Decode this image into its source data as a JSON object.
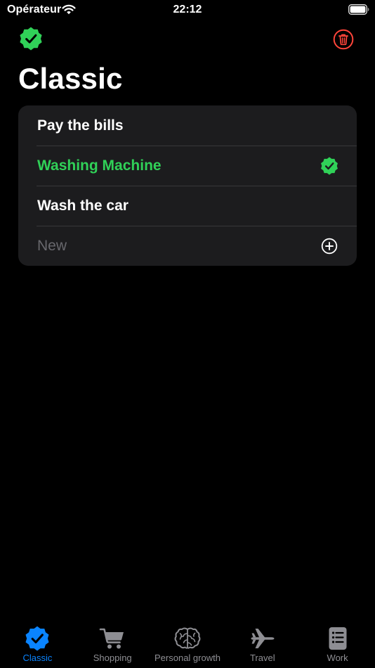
{
  "status_bar": {
    "carrier": "Opérateur",
    "time": "22:12"
  },
  "page": {
    "title": "Classic"
  },
  "list": {
    "items": [
      {
        "label": "Pay the bills",
        "completed": false
      },
      {
        "label": "Washing Machine",
        "completed": true
      },
      {
        "label": "Wash the car",
        "completed": false
      }
    ],
    "new_item": {
      "value": "",
      "placeholder": "New"
    }
  },
  "tab_bar": {
    "tabs": [
      {
        "label": "Classic",
        "icon": "checkmark-seal-icon",
        "active": true
      },
      {
        "label": "Shopping",
        "icon": "cart-icon",
        "active": false
      },
      {
        "label": "Personal growth",
        "icon": "brain-icon",
        "active": false
      },
      {
        "label": "Travel",
        "icon": "airplane-icon",
        "active": false
      },
      {
        "label": "Work",
        "icon": "notepad-icon",
        "active": false
      }
    ]
  },
  "colors": {
    "accent": "#0a84ff",
    "done_green": "#30d158",
    "delete_red": "#ff453a",
    "card_background": "#1c1c1e",
    "inactive_tab": "#8e8e93"
  }
}
